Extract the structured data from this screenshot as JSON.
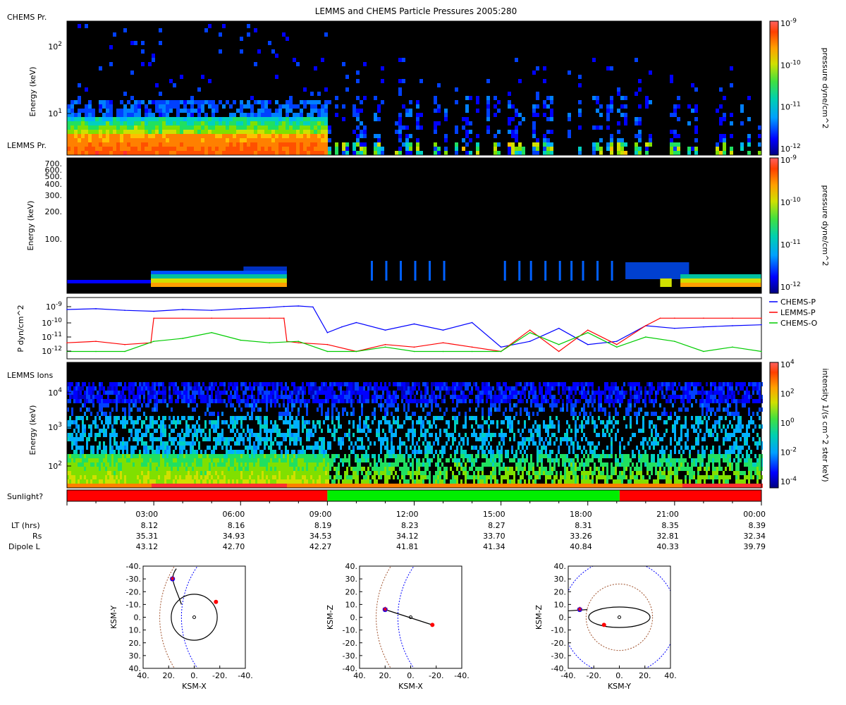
{
  "title": "LEMMS and CHEMS Particle Pressures  2005:280",
  "colors": {
    "chems_p": "#0000ff",
    "lemms_p": "#ff0000",
    "chems_o": "#00cc00",
    "sunlight_no": "#ff0000",
    "sunlight_yes": "#00ee00"
  },
  "panel1": {
    "label_top": "CHEMS Pr.",
    "label_bottom": "LEMMS Pr.",
    "ylabel": "Energy (keV)",
    "yticks": [
      "10^2",
      "10^1"
    ],
    "colorbar": {
      "label": "pressure dyne/cm^2",
      "ticks": [
        "10^-9",
        "10^-10",
        "10^-11",
        "10^-12"
      ]
    }
  },
  "panel2": {
    "ylabel": "Energy (keV)",
    "yticks": [
      "700.",
      "600.",
      "500.",
      "400.",
      "300.",
      "200.",
      "100."
    ],
    "colorbar": {
      "label": "pressure dyne/cm^2",
      "ticks": [
        "10^-9",
        "10^-10",
        "10^-11",
        "10^-12"
      ]
    }
  },
  "panel3": {
    "ylabel": "P dyn/cm^2",
    "yticks": [
      "10^-9",
      "10^-10",
      "10^-11",
      "10^-12"
    ],
    "legend": [
      "CHEMS-P",
      "LEMMS-P",
      "CHEMS-O"
    ]
  },
  "panel4": {
    "label_top": "LEMMS Ions",
    "ylabel": "Energy (keV)",
    "yticks": [
      "10^4",
      "10^3",
      "10^2"
    ],
    "colorbar": {
      "label": "intensity 1/(s cm^2 ster keV)",
      "ticks": [
        "10^4",
        "10^2",
        "10^0",
        "10^-2",
        "10^-4"
      ]
    }
  },
  "sunlight": {
    "label": "Sunlight?",
    "segments": [
      {
        "from": 0,
        "to": 9.0,
        "state": "no"
      },
      {
        "from": 9.0,
        "to": 19.1,
        "state": "yes"
      },
      {
        "from": 19.1,
        "to": 24,
        "state": "no"
      }
    ]
  },
  "time_axis": {
    "ticks": [
      "03:00",
      "06:00",
      "09:00",
      "12:00",
      "15:00",
      "18:00",
      "21:00",
      "00:00"
    ],
    "rows": [
      {
        "label": "LT (hrs)",
        "values": [
          "8.12",
          "8.16",
          "8.19",
          "8.23",
          "8.27",
          "8.31",
          "8.35",
          "8.39"
        ]
      },
      {
        "label": "Rs",
        "values": [
          "35.31",
          "34.93",
          "34.53",
          "34.12",
          "33.70",
          "33.26",
          "32.81",
          "32.34"
        ]
      },
      {
        "label": "Dipole L",
        "values": [
          "43.12",
          "42.70",
          "42.27",
          "41.81",
          "41.34",
          "40.84",
          "40.33",
          "39.79"
        ]
      }
    ]
  },
  "chart_data": [
    {
      "type": "line",
      "title": "LEMMS and CHEMS Particle Pressures  2005:280",
      "ylabel": "P dyn/cm^2",
      "x_unit": "hours",
      "ylim": [
        1e-12,
        2e-09
      ],
      "log_y": true,
      "series": [
        {
          "name": "CHEMS-P",
          "x": [
            0,
            1,
            2,
            3,
            4,
            5,
            6,
            7,
            7.5,
            8,
            8.5,
            9,
            9.5,
            10,
            11,
            12,
            13,
            14,
            15,
            16,
            17,
            18,
            19,
            20,
            21,
            22,
            23,
            24
          ],
          "values": [
            8e-10,
            9e-10,
            7e-10,
            6e-10,
            8e-10,
            7e-10,
            9e-10,
            1.1e-09,
            1.3e-09,
            1.4e-09,
            1.2e-09,
            2e-11,
            5e-11,
            1e-10,
            3e-11,
            8e-11,
            3e-11,
            1e-10,
            2e-12,
            5e-12,
            4e-11,
            3e-12,
            5e-12,
            6e-11,
            4e-11,
            5e-11,
            6e-11,
            7e-11
          ]
        },
        {
          "name": "LEMMS-P",
          "x": [
            0,
            1,
            2,
            2.9,
            3,
            5,
            7,
            7.5,
            7.6,
            8,
            9,
            10,
            11,
            12,
            13,
            14,
            15,
            16,
            17,
            18,
            19,
            20,
            20.5,
            21,
            22,
            23,
            24
          ],
          "values": [
            4e-12,
            5e-12,
            3e-12,
            4e-12,
            2e-10,
            2e-10,
            2e-10,
            2e-10,
            5e-12,
            4e-12,
            3e-12,
            1e-12,
            3e-12,
            2e-12,
            4e-12,
            2e-12,
            1e-12,
            3e-11,
            1e-12,
            3e-11,
            3e-12,
            6e-11,
            2e-10,
            2e-10,
            2e-10,
            2e-10,
            2e-10
          ]
        },
        {
          "name": "CHEMS-O",
          "x": [
            0,
            1,
            2,
            3,
            4,
            5,
            6,
            7,
            8,
            9,
            10,
            11,
            12,
            13,
            14,
            15,
            16,
            17,
            18,
            19,
            20,
            21,
            22,
            23,
            24
          ],
          "values": [
            1e-12,
            1e-12,
            1e-12,
            5e-12,
            8e-12,
            2e-11,
            6e-12,
            4e-12,
            5e-12,
            1e-12,
            1e-12,
            2e-12,
            1e-12,
            1e-12,
            1e-12,
            1e-12,
            2e-11,
            3e-12,
            2e-11,
            2e-12,
            1e-11,
            5e-12,
            1e-12,
            2e-12,
            1e-12
          ]
        }
      ]
    },
    {
      "type": "line",
      "xlabel": "KSM-X",
      "ylabel": "KSM-Y",
      "xlim": [
        40,
        -40
      ],
      "ylim": [
        -40,
        40
      ],
      "xticks": [
        "40.",
        "20.",
        "0.",
        "-20.",
        "-40."
      ],
      "yticks": [
        "-40.",
        "-30.",
        "-20.",
        "-10.",
        "0.",
        "10.",
        "20.",
        "30.",
        "40."
      ],
      "start_marker": [
        17,
        -30
      ],
      "end_marker": [
        -17,
        -12
      ]
    },
    {
      "type": "line",
      "xlabel": "KSM-X",
      "ylabel": "KSM-Z",
      "xlim": [
        40,
        -40
      ],
      "ylim": [
        40,
        -40
      ],
      "xticks": [
        "40.",
        "20.",
        "0.",
        "-20.",
        "-40."
      ],
      "yticks": [
        "40.",
        "30.",
        "20.",
        "10.",
        "0.",
        "-10.",
        "-20.",
        "-30.",
        "-40."
      ],
      "start_marker": [
        20,
        6
      ],
      "end_marker": [
        -17,
        -6
      ]
    },
    {
      "type": "line",
      "xlabel": "KSM-Y",
      "ylabel": "KSM-Z",
      "xlim": [
        -40,
        40
      ],
      "ylim": [
        40,
        -40
      ],
      "xticks": [
        "-40.",
        "-20.",
        "0.",
        "20.",
        "40."
      ],
      "yticks": [
        "40.",
        "30.",
        "20.",
        "10.",
        "0.",
        "-10.",
        "-20.",
        "-30.",
        "-40."
      ],
      "start_marker": [
        -31,
        6
      ],
      "end_marker": [
        -12,
        -6
      ]
    }
  ]
}
